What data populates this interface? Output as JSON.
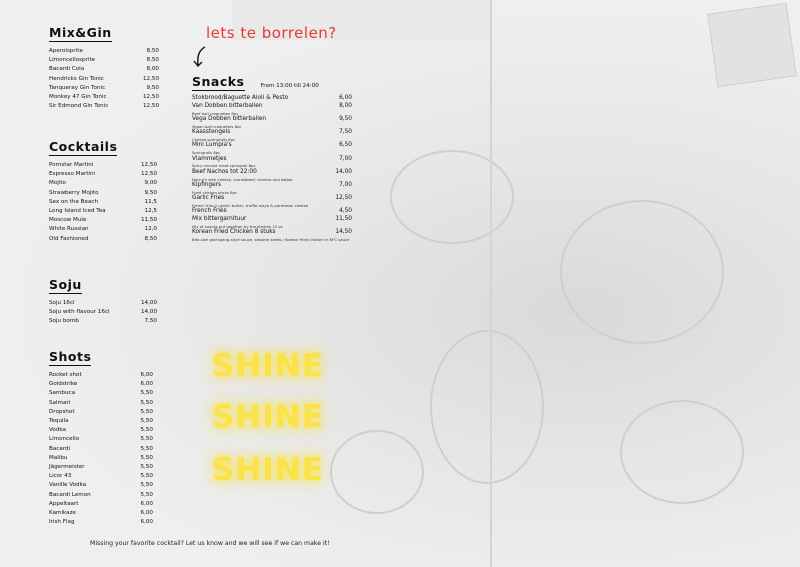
{
  "mix_gin": {
    "title": "Mix&Gin",
    "items": [
      {
        "name": "Aperolsprite",
        "price": "8,50"
      },
      {
        "name": "Limoncellosprite",
        "price": "8,50"
      },
      {
        "name": "Bacardi Cola",
        "price": "8,00"
      },
      {
        "name": "Hendricks Gin Tonic",
        "price": "12,50"
      },
      {
        "name": "Tanqueray Gin Tonic",
        "price": "9,50"
      },
      {
        "name": "Monkey 47 Gin Tonic",
        "price": "12,50"
      },
      {
        "name": "Sir Edmond Gin Tonic",
        "price": "12,50"
      }
    ]
  },
  "cocktails": {
    "title": "Cocktails",
    "items": [
      {
        "name": "Pornstar Martini",
        "price": "12,50"
      },
      {
        "name": "Espresso Martini",
        "price": "12,50"
      },
      {
        "name": "Mojito",
        "price": "9,00"
      },
      {
        "name": "Strawberry Mojito",
        "price": "9,50"
      },
      {
        "name": "Sex on the Beach",
        "price": "11,5"
      },
      {
        "name": "Long Island Iced Tea",
        "price": "12,5"
      },
      {
        "name": "Moscow Mule",
        "price": "11,50"
      },
      {
        "name": "White Russian",
        "price": "12,0"
      },
      {
        "name": "Old Fashioned",
        "price": "8,50"
      }
    ]
  },
  "soju": {
    "title": "Soju",
    "items": [
      {
        "name": "Soju 16cl",
        "price": "14,00"
      },
      {
        "name": "Soju with flavour 16cl",
        "price": "14,00"
      },
      {
        "name": "Soju bomb",
        "price": "7,50"
      }
    ]
  },
  "shots": {
    "title": "Shots",
    "items": [
      {
        "name": "Rocket shot",
        "price": "6,00"
      },
      {
        "name": "Goldstrike",
        "price": "6,00"
      },
      {
        "name": "Sambuca",
        "price": "5,50"
      },
      {
        "name": "Salmari",
        "price": "5,50"
      },
      {
        "name": "Dropshot",
        "price": "5,50"
      },
      {
        "name": "Tequila",
        "price": "5,50"
      },
      {
        "name": "Vodka",
        "price": "5,50"
      },
      {
        "name": "Limoncello",
        "price": "5,50"
      },
      {
        "name": "Bacardi",
        "price": "5,50"
      },
      {
        "name": "Malibu",
        "price": "5,50"
      },
      {
        "name": "Jägermeister",
        "price": "5,50"
      },
      {
        "name": "Licor 43",
        "price": "5,50"
      },
      {
        "name": "Vanille Vodka",
        "price": "5,50"
      },
      {
        "name": "Bacardi Lemon",
        "price": "5,50"
      },
      {
        "name": "Appeltaart",
        "price": "6,00"
      },
      {
        "name": "Kamikaze",
        "price": "6,00"
      },
      {
        "name": "Irish Flag",
        "price": "6,00"
      }
    ]
  },
  "snacks": {
    "title": "Snacks",
    "from": "From 13:00 till 24:00",
    "items": [
      {
        "name": "Stokbrood/Baguette Aioli & Pesto",
        "price": "6,00",
        "desc": ""
      },
      {
        "name": "Van Dobben bitterballen",
        "price": "8,00",
        "desc": "Beef ball croquettes 8pc"
      },
      {
        "name": "Vega Dobben bitterballen",
        "price": "9,50",
        "desc": "Vegan ball croquettes 8pc"
      },
      {
        "name": "Kaasstengels",
        "price": "7,50",
        "desc": "Cheese springrolls 8pc"
      },
      {
        "name": "Mini Lumpia's",
        "price": "6,50",
        "desc": "Springrolls 8pc"
      },
      {
        "name": "Vlammetjes",
        "price": "7,00",
        "desc": "Spicy minced meat springroll 8pc"
      },
      {
        "name": "Beef Nachos tot 22:00",
        "price": "14,00",
        "desc": "Nacho's with cheese, cornedbeef, cilantro and ketjap"
      },
      {
        "name": "Kipfingers",
        "price": "7,00",
        "desc": "Fried chicken sticks 8pc"
      },
      {
        "name": "Garlic Fries",
        "price": "12,50",
        "desc": "French fries in garlic butter, truffle mayo & parmesan cheese"
      },
      {
        "name": "French Fries",
        "price": "4,50",
        "desc": ""
      },
      {
        "name": "Mix bittergarnituur",
        "price": "11,50",
        "desc": "Mix of snacks put together by the kitchen 12 pc"
      },
      {
        "name": "Korean Fried Chicken 8 stuks",
        "price": "14,50",
        "desc": "Bite-size gochujang-style sauce, sesame seeds / Korean fried chicken in KFC sauce"
      }
    ]
  },
  "tagline": "lets te borrelen?",
  "shine": [
    "SHINE",
    "SHINE",
    "SHINE"
  ],
  "footer": "Missing your favorite cocktail? Let us know and we will see if we can make it!",
  "colors": {
    "accent_red": "#e53935",
    "shine_yellow": "#f9e24a"
  }
}
